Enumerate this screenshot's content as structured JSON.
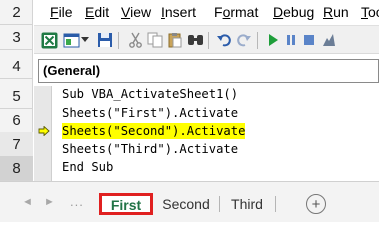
{
  "rows": [
    "2",
    "3",
    "4",
    "5",
    "6",
    "7",
    "8"
  ],
  "menu": [
    {
      "label": "File",
      "underline": "F",
      "rest": "ile"
    },
    {
      "label": "Edit",
      "underline": "E",
      "rest": "dit"
    },
    {
      "label": "View",
      "underline": "V",
      "rest": "iew"
    },
    {
      "label": "Insert",
      "underline": "I",
      "rest": "nsert"
    },
    {
      "label": "Format",
      "underline": "o",
      "pre": "F",
      "rest": "rmat"
    },
    {
      "label": "Debug",
      "underline": "D",
      "rest": "ebug"
    },
    {
      "label": "Run",
      "underline": "R",
      "rest": "un"
    },
    {
      "label": "Tools",
      "underline": "T",
      "rest": "ools"
    }
  ],
  "toolbar": {
    "icons": [
      "excel-icon",
      "insert-module-icon",
      "dropdown-arrow-icon",
      "save-icon",
      "cut-icon",
      "copy-icon",
      "paste-icon",
      "find-icon",
      "undo-icon",
      "redo-icon",
      "run-icon",
      "break-icon",
      "reset-icon",
      "design-mode-icon"
    ]
  },
  "procedure_box": {
    "value": "(General)"
  },
  "code": {
    "lines": [
      "Sub VBA_ActivateSheet1()",
      "Sheets(\"First\").Activate",
      "Sheets(\"Second\").Activate",
      "Sheets(\"Third\").Activate",
      "End Sub"
    ],
    "highlight_line_index": 2,
    "highlight_color": "#ffff00"
  },
  "sheet_tabs": {
    "tabs": [
      "First",
      "Second",
      "Third"
    ],
    "active": "First",
    "nav_left": "◄",
    "nav_right": "►",
    "overflow": "...",
    "add_label": "+"
  },
  "colors": {
    "accent_green": "#217346",
    "active_tab_border": "#e02020"
  }
}
